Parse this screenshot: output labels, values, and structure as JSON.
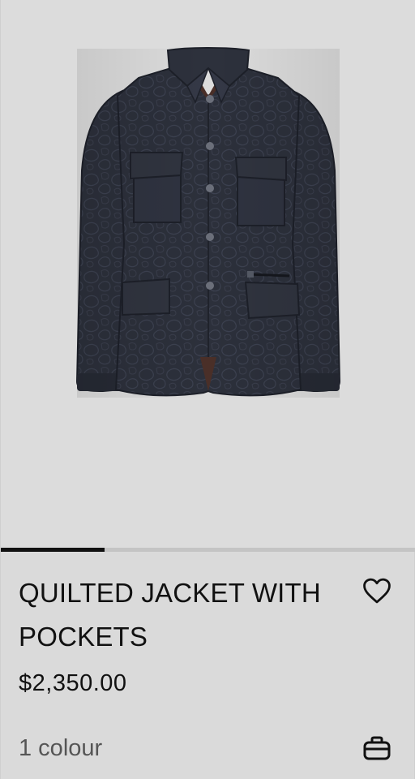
{
  "product": {
    "title": "QUILTED JACKET WITH POCKETS",
    "price": "$2,350.00",
    "colours": "1 colour",
    "gallery_progress": 0.25
  },
  "icons": {
    "wishlist": "heart-outline-icon",
    "add_to_bag": "shopping-bag-icon"
  },
  "colors": {
    "background": "#dadada",
    "text": "#111111",
    "secondary_text": "#555555",
    "jacket": "#2b2f3a"
  }
}
